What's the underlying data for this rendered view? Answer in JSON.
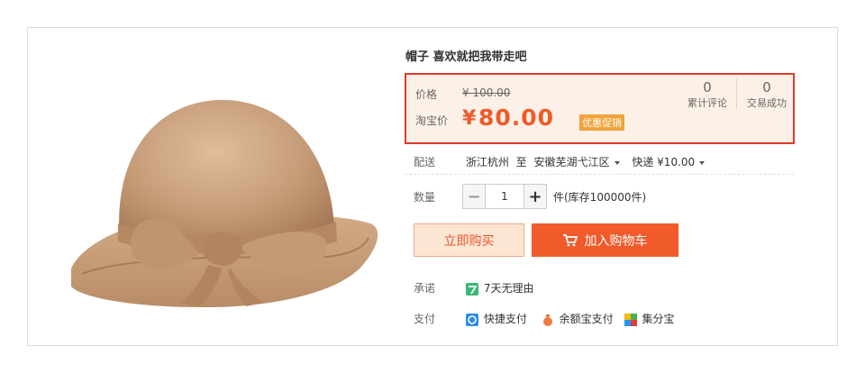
{
  "product": {
    "title": "帽子 喜欢就把我带走吧"
  },
  "price": {
    "price_label": "价格",
    "original": "¥ 100.00",
    "taobao_label": "淘宝价",
    "currency": "¥",
    "current": "80.00",
    "promo_tag": "优惠促销"
  },
  "stats": [
    {
      "count": "0",
      "label": "累计评论"
    },
    {
      "count": "0",
      "label": "交易成功"
    }
  ],
  "shipping": {
    "label": "配送",
    "from": "浙江杭州",
    "to_word": "至",
    "to": "安徽芜湖弋江区",
    "express": "快递 ¥10.00"
  },
  "quantity": {
    "label": "数量",
    "value": "1",
    "minus": "−",
    "plus": "+",
    "stock": "件(库存100000件)"
  },
  "actions": {
    "buy_now": "立即购买",
    "add_to_cart": "加入购物车"
  },
  "promise": {
    "label": "承诺",
    "item": "7天无理由"
  },
  "payment": {
    "label": "支付",
    "methods": [
      "快捷支付",
      "余额宝支付",
      "集分宝"
    ]
  },
  "colors": {
    "accent": "#f15a2b",
    "border_highlight": "#e4392a",
    "price_bg": "#fdf1e7"
  }
}
